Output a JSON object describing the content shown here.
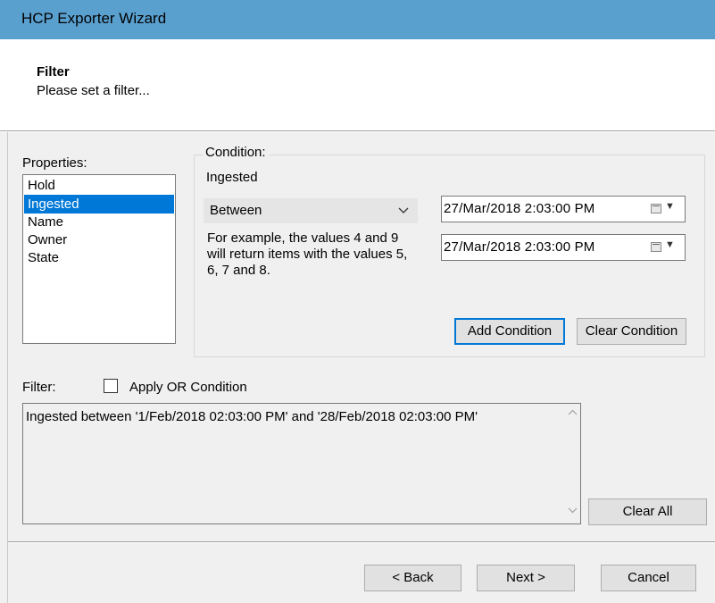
{
  "window": {
    "title": "HCP Exporter Wizard"
  },
  "header": {
    "title": "Filter",
    "subtitle": "Please set a filter..."
  },
  "properties": {
    "label": "Properties:",
    "items": [
      "Hold",
      "Ingested",
      "Name",
      "Owner",
      "State"
    ],
    "selected": "Ingested"
  },
  "condition": {
    "group_label": "Condition:",
    "property": "Ingested",
    "operator": "Between",
    "example": "For example, the values 4 and 9 will return items with the values 5, 6, 7 and 8.",
    "date_from": "27/Mar/2018   2:03:00 PM",
    "date_to": "27/Mar/2018   2:03:00 PM",
    "add_label": "Add Condition",
    "clear_label": "Clear Condition"
  },
  "filter": {
    "label": "Filter:",
    "or_label": "Apply OR Condition",
    "or_checked": false,
    "text": "Ingested between '1/Feb/2018 02:03:00 PM' and '28/Feb/2018 02:03:00 PM'",
    "clear_all_label": "Clear All"
  },
  "footer": {
    "back_label": "< Back",
    "next_label": "Next >",
    "cancel_label": "Cancel"
  },
  "icons": {
    "combo_arrow": "chevron-down-icon",
    "calendar": "calendar-icon",
    "scroll_up": "scroll-up-icon",
    "scroll_down": "scroll-down-icon"
  },
  "colors": {
    "titlebar": "#5aa0cf",
    "selection": "#0078d7",
    "default_button_border": "#0078d7"
  }
}
